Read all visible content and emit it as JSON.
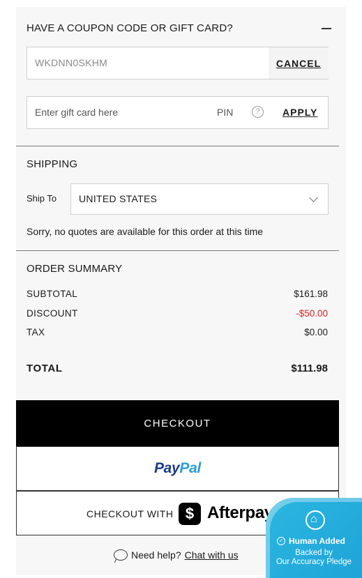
{
  "coupon": {
    "heading": "HAVE A COUPON CODE OR GIFT CARD?",
    "code_value": "WKDNN0SKHM",
    "cancel_label": "CANCEL",
    "gift_placeholder": "Enter gift card here",
    "pin_label": "PIN",
    "help_glyph": "?",
    "apply_label": "APPLY"
  },
  "shipping": {
    "heading": "SHIPPING",
    "ship_to_label": "Ship To",
    "country": "UNITED STATES",
    "message": "Sorry, no quotes are available for this order at this time"
  },
  "summary": {
    "heading": "ORDER SUMMARY",
    "subtotal_label": "SUBTOTAL",
    "subtotal_value": "$161.98",
    "discount_label": "DISCOUNT",
    "discount_value": "-$50.00",
    "tax_label": "TAX",
    "tax_value": "$0.00",
    "total_label": "TOTAL",
    "total_value": "$111.98",
    "discount_color": "#e02020"
  },
  "buttons": {
    "checkout_label": "CHECKOUT",
    "paypal_pay": "Pay",
    "paypal_pal": "Pal",
    "afterpay_prefix": "CHECKOUT WITH",
    "afterpay_symbol": "$",
    "afterpay_name": "Afterpay"
  },
  "help": {
    "text": "Need help?",
    "link": "Chat with us"
  },
  "pledge": {
    "title": "Human Added",
    "check_glyph": "✓",
    "line1": "Backed by",
    "line2": "Our Accuracy Pledge",
    "color": "#1ea4d8"
  },
  "icons": [
    "minus-icon",
    "help-circle-icon",
    "chevron-down-icon",
    "chat-bubble-icon",
    "home-icon",
    "check-circle-icon"
  ]
}
